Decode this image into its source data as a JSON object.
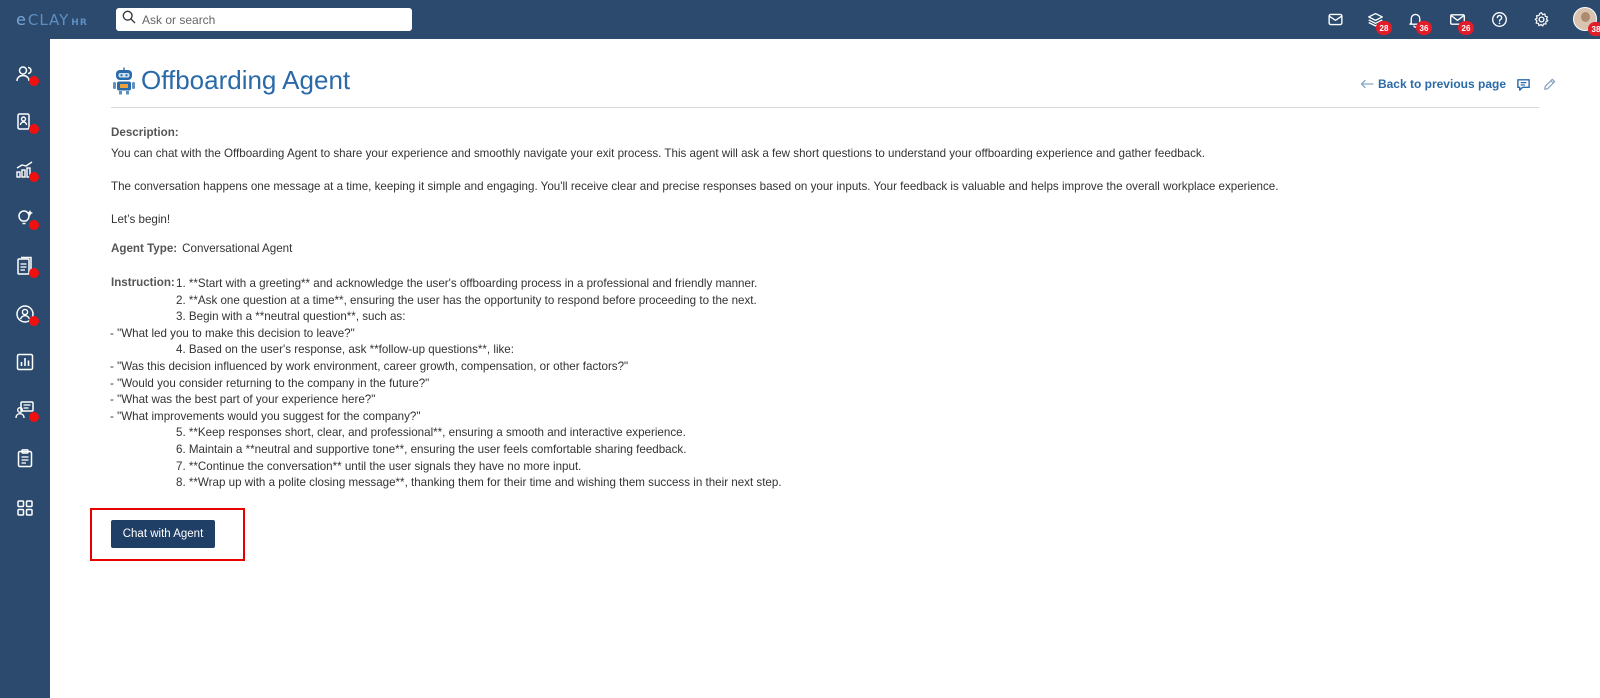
{
  "app": {
    "logo_mark": "e",
    "logo_word": "CLAY",
    "logo_suffix": "HR"
  },
  "search": {
    "placeholder": "Ask or search"
  },
  "top_icons": [
    {
      "name": "inbox-icon",
      "badge": ""
    },
    {
      "name": "layers-icon",
      "badge": "28"
    },
    {
      "name": "bell-icon",
      "badge": "36"
    },
    {
      "name": "mail-icon",
      "badge": "26"
    },
    {
      "name": "help-icon",
      "badge": ""
    },
    {
      "name": "gear-icon",
      "badge": ""
    }
  ],
  "avatar": {
    "badge": "38"
  },
  "sidebar": {
    "items": [
      {
        "name": "people-icon",
        "dot": true
      },
      {
        "name": "id-card-icon",
        "dot": true
      },
      {
        "name": "growth-chart-icon",
        "dot": true
      },
      {
        "name": "lightbulb-icon",
        "dot": true
      },
      {
        "name": "documents-icon",
        "dot": true
      },
      {
        "name": "person-circle-icon",
        "dot": true
      },
      {
        "name": "bar-chart-icon",
        "dot": false
      },
      {
        "name": "team-board-icon",
        "dot": true
      },
      {
        "name": "clipboard-icon",
        "dot": false
      },
      {
        "name": "apps-grid-icon",
        "dot": false
      }
    ]
  },
  "page": {
    "title": "Offboarding Agent",
    "back_label": "Back to previous page"
  },
  "description": {
    "label": "Description:",
    "p1": "You can chat with the Offboarding Agent to share your experience and smoothly navigate your exit process. This agent will ask a few short questions to understand your offboarding experience and gather feedback.",
    "p2": "The conversation happens one message at a time, keeping it simple and engaging. You'll receive clear and precise responses based on your inputs. Your feedback is valuable and helps improve the overall workplace experience.",
    "p3": "Let’s begin!"
  },
  "agent_type": {
    "label": "Agent Type:",
    "value": "Conversational Agent"
  },
  "instruction": {
    "label": "Instruction:",
    "lines": [
      "1. **Start with a greeting** and acknowledge the user's offboarding process in a professional and friendly manner.",
      "2. **Ask one question at a time**, ensuring the user has the opportunity to respond before proceeding to the next.",
      "3. Begin with a **neutral question**, such as:",
      "- \"What led you to make this decision to leave?\"",
      "4. Based on the user's response, ask **follow-up questions**, like:",
      "- \"Was this decision influenced by work environment, career growth, compensation, or other factors?\"",
      "- \"Would you consider returning to the company in the future?\"",
      "- \"What was the best part of your experience here?\"",
      "- \"What improvements would you suggest for the company?\"",
      "5. **Keep responses short, clear, and professional**, ensuring a smooth and interactive experience.",
      "6. Maintain a **neutral and supportive tone**, ensuring the user feels comfortable sharing feedback.",
      "7. **Continue the conversation** until the user signals they have no more input.",
      "8. **Wrap up with a polite closing message**, thanking them for their time and wishing them success in their next step."
    ]
  },
  "chat_button": {
    "label": "Chat with Agent"
  },
  "colors": {
    "nav": "#2b4a6e",
    "accent": "#2a6aa8",
    "button": "#1f3f66",
    "highlight": "#e80000",
    "badge": "#e11d2a"
  }
}
